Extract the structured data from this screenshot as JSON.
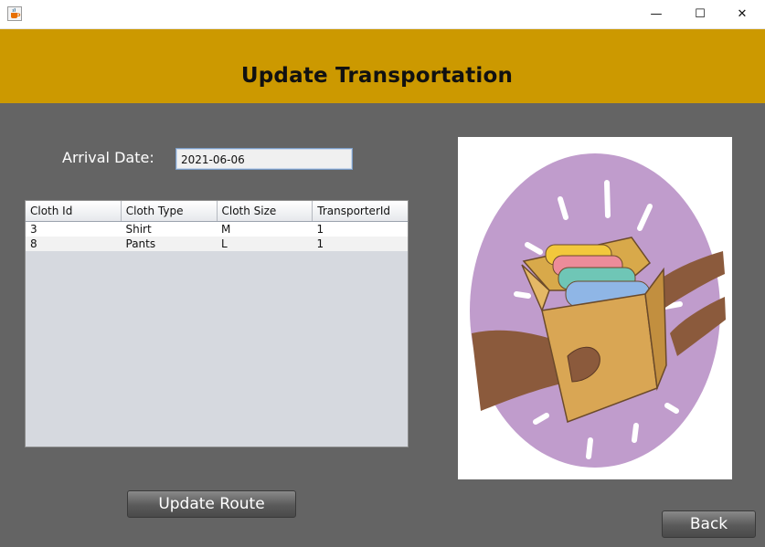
{
  "window": {
    "app_icon": "java-coffee-icon",
    "controls": {
      "minimize": "—",
      "maximize": "☐",
      "close": "✕"
    }
  },
  "header": {
    "title": "Update Transportation",
    "background_color": "#cc9900"
  },
  "form": {
    "arrival_label": "Arrival Date:",
    "arrival_value": "2021-06-06"
  },
  "table": {
    "columns": [
      "Cloth Id",
      "Cloth Type",
      "Cloth Size",
      "TransporterId"
    ],
    "rows": [
      [
        "3",
        "Shirt",
        "M",
        "1"
      ],
      [
        "8",
        "Pants",
        "L",
        "1"
      ]
    ]
  },
  "illustration": {
    "icon": "clothes-delivery-box-illustration"
  },
  "buttons": {
    "update_route": "Update Route",
    "back": "Back"
  },
  "colors": {
    "content_background": "#646464",
    "illustration_circle": "#c09ccc"
  }
}
